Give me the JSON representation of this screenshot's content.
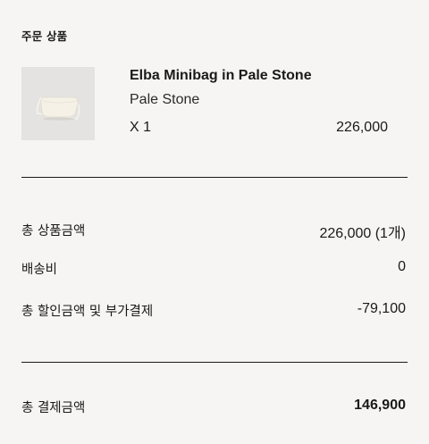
{
  "section_title": "주문 상품",
  "product": {
    "thumbnail_icon": "minibag-image",
    "name": "Elba Minibag in Pale Stone",
    "variant": "Pale Stone",
    "quantity": "X 1",
    "price": "226,000"
  },
  "summary": {
    "subtotal_label": "총 상품금액",
    "subtotal_value": "226,000 (1개)",
    "shipping_label": "배송비",
    "shipping_value": "0",
    "discount_label": "총 할인금액 및 부가결제",
    "discount_value": "-79,100"
  },
  "total": {
    "label": "총 결제금액",
    "value": "146,900"
  }
}
